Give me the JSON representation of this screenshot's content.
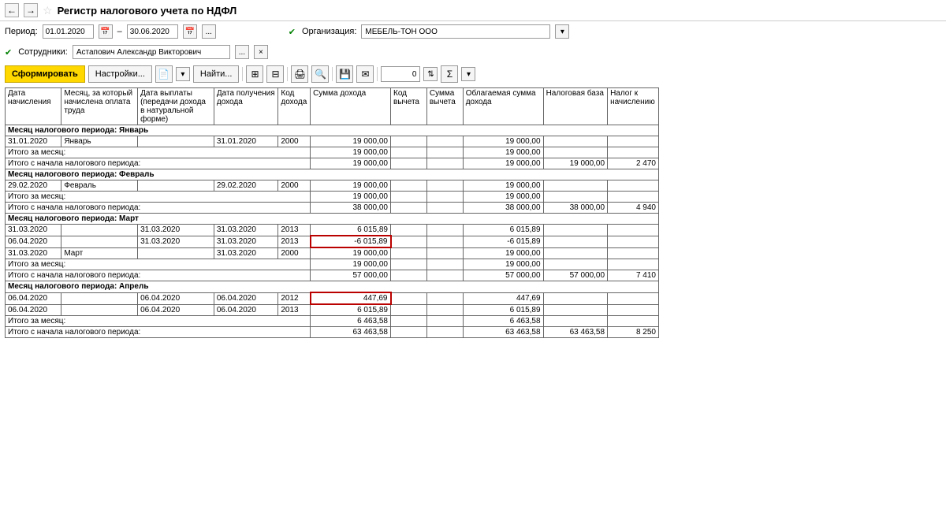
{
  "title": "Регистр налогового учета по НДФЛ",
  "filters": {
    "period_label": "Период:",
    "date_from": "01.01.2020",
    "date_to": "30.06.2020",
    "dash": "–",
    "org_label": "Организация:",
    "org_value": "МЕБЕЛЬ-ТОН ООО",
    "emp_label": "Сотрудники:",
    "emp_value": "Астапович Александр Викторович",
    "dots": "..."
  },
  "toolbar": {
    "form": "Сформировать",
    "settings": "Настройки...",
    "find": "Найти...",
    "zero": "0"
  },
  "headers": {
    "c1": "Дата начисления",
    "c2": "Месяц, за который начислена оплата труда",
    "c3": "Дата выплаты (передачи дохода в натуральной форме)",
    "c4": "Дата получения дохода",
    "c5": "Код дохода",
    "c6": "Сумма дохода",
    "c7": "Код вычета",
    "c8": "Сумма вычета",
    "c9": "Облагаемая сумма дохода",
    "c10": "Налоговая база",
    "c11": "Налог к начислению"
  },
  "labels": {
    "month_total": "Итого за месяц:",
    "period_total": "Итого с начала налогового периода:"
  },
  "groups": [
    {
      "title": "Месяц налогового периода: Январь",
      "rows": [
        {
          "c1": "31.01.2020",
          "c2": "Январь",
          "c3": "",
          "c4": "31.01.2020",
          "c5": "2000",
          "c6": "19 000,00",
          "c7": "",
          "c8": "",
          "c9": "19 000,00",
          "c10": "",
          "c11": ""
        }
      ],
      "month_total": {
        "c6": "19 000,00",
        "c9": "19 000,00"
      },
      "period_total": {
        "c6": "19 000,00",
        "c9": "19 000,00",
        "c10": "19 000,00",
        "c11": "2 470"
      }
    },
    {
      "title": "Месяц налогового периода: Февраль",
      "rows": [
        {
          "c1": "29.02.2020",
          "c2": "Февраль",
          "c3": "",
          "c4": "29.02.2020",
          "c5": "2000",
          "c6": "19 000,00",
          "c7": "",
          "c8": "",
          "c9": "19 000,00",
          "c10": "",
          "c11": ""
        }
      ],
      "month_total": {
        "c6": "19 000,00",
        "c9": "19 000,00"
      },
      "period_total": {
        "c6": "38 000,00",
        "c9": "38 000,00",
        "c10": "38 000,00",
        "c11": "4 940"
      }
    },
    {
      "title": "Месяц налогового периода: Март",
      "rows": [
        {
          "c1": "31.03.2020",
          "c2": "",
          "c3": "31.03.2020",
          "c4": "31.03.2020",
          "c5": "2013",
          "c6": "6 015,89",
          "c7": "",
          "c8": "",
          "c9": "6 015,89",
          "c10": "",
          "c11": ""
        },
        {
          "c1": "06.04.2020",
          "c2": "",
          "c3": "31.03.2020",
          "c4": "31.03.2020",
          "c5": "2013",
          "c6": "-6 015,89",
          "c7": "",
          "c8": "",
          "c9": "-6 015,89",
          "c10": "",
          "c11": "",
          "hl": "c6"
        },
        {
          "c1": "31.03.2020",
          "c2": "Март",
          "c3": "",
          "c4": "31.03.2020",
          "c5": "2000",
          "c6": "19 000,00",
          "c7": "",
          "c8": "",
          "c9": "19 000,00",
          "c10": "",
          "c11": ""
        }
      ],
      "month_total": {
        "c6": "19 000,00",
        "c9": "19 000,00"
      },
      "period_total": {
        "c6": "57 000,00",
        "c9": "57 000,00",
        "c10": "57 000,00",
        "c11": "7 410"
      }
    },
    {
      "title": "Месяц налогового периода: Апрель",
      "rows": [
        {
          "c1": "06.04.2020",
          "c2": "",
          "c3": "06.04.2020",
          "c4": "06.04.2020",
          "c5": "2012",
          "c6": "447,69",
          "c7": "",
          "c8": "",
          "c9": "447,69",
          "c10": "",
          "c11": "",
          "hl": "c6"
        },
        {
          "c1": "06.04.2020",
          "c2": "",
          "c3": "06.04.2020",
          "c4": "06.04.2020",
          "c5": "2013",
          "c6": "6 015,89",
          "c7": "",
          "c8": "",
          "c9": "6 015,89",
          "c10": "",
          "c11": ""
        }
      ],
      "month_total": {
        "c6": "6 463,58",
        "c9": "6 463,58"
      },
      "period_total": {
        "c6": "63 463,58",
        "c9": "63 463,58",
        "c10": "63 463,58",
        "c11": "8 250"
      }
    }
  ]
}
